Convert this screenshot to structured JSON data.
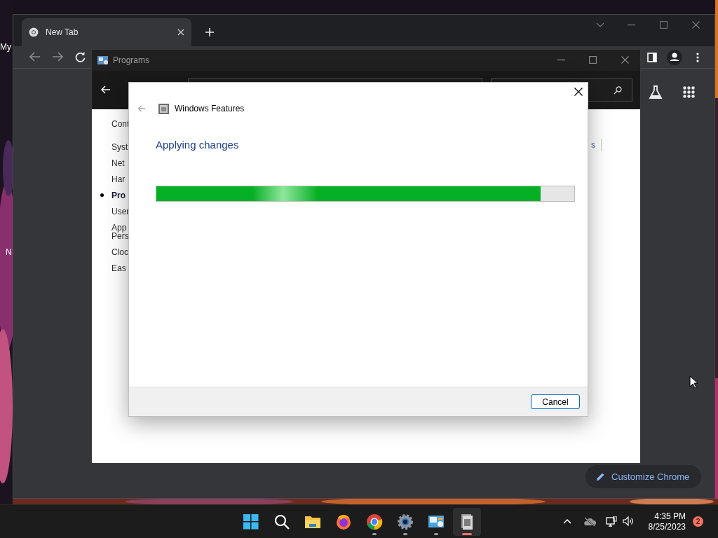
{
  "desktop": {
    "icon_labels": [
      "My",
      "N"
    ]
  },
  "browser": {
    "tabs": [
      {
        "title": "New Tab",
        "selected": true
      }
    ],
    "customize_button": "Customize Chrome"
  },
  "control_panel": {
    "title": "Programs",
    "sidebar": [
      {
        "lines": [
          "Cont"
        ],
        "selected": false
      },
      {
        "lines": [
          "Syst"
        ],
        "selected": false
      },
      {
        "lines": [
          "Net"
        ],
        "selected": false
      },
      {
        "lines": [
          "Har"
        ],
        "selected": false
      },
      {
        "lines": [
          "Pro"
        ],
        "selected": true
      },
      {
        "lines": [
          "User"
        ],
        "selected": false
      },
      {
        "lines": [
          "App",
          "Pers"
        ],
        "selected": false
      },
      {
        "lines": [
          "Cloc"
        ],
        "selected": false
      },
      {
        "lines": [
          "Eas"
        ],
        "selected": false
      }
    ],
    "link_fragment": "s"
  },
  "dialog": {
    "title": "Windows Features",
    "heading": "Applying changes",
    "progress": {
      "level": 0.92
    },
    "buttons": [
      "Cancel"
    ]
  },
  "taskbar": {
    "apps": [
      {
        "kind": "start",
        "running": false,
        "selected": false
      },
      {
        "kind": "search",
        "running": false,
        "selected": false
      },
      {
        "kind": "explorer",
        "running": false,
        "selected": false
      },
      {
        "kind": "firefox",
        "running": false,
        "selected": false
      },
      {
        "kind": "chrome",
        "running": true,
        "selected": false
      },
      {
        "kind": "settings",
        "running": true,
        "selected": false
      },
      {
        "kind": "controlpanel",
        "running": true,
        "selected": false
      },
      {
        "kind": "features",
        "running": true,
        "selected": true
      }
    ],
    "clock": {
      "time": "4:35 PM",
      "date": "8/25/2023"
    },
    "notification_count": "2"
  }
}
